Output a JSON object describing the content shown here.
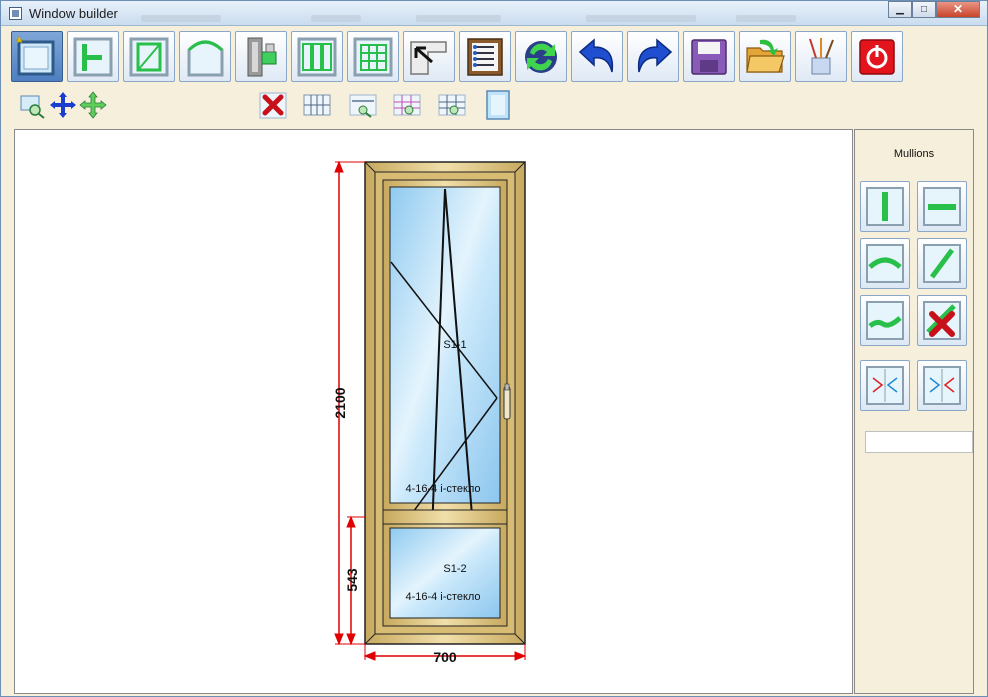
{
  "window": {
    "title": "Window builder",
    "minimize_glyph": "▁",
    "maximize_glyph": "□",
    "close_glyph": "✕"
  },
  "toolbar": {
    "items": [
      {
        "icon": "new-window-icon"
      },
      {
        "icon": "mullion-icon"
      },
      {
        "icon": "sash-icon"
      },
      {
        "icon": "arch-icon"
      },
      {
        "icon": "profile-icon"
      },
      {
        "icon": "triple-sash-icon"
      },
      {
        "icon": "grid-layout-icon"
      },
      {
        "icon": "corner-connector-icon"
      },
      {
        "icon": "properties-list-icon"
      },
      {
        "icon": "refresh-icon"
      },
      {
        "icon": "undo-icon"
      },
      {
        "icon": "redo-icon"
      },
      {
        "icon": "save-icon"
      },
      {
        "icon": "open-folder-icon"
      },
      {
        "icon": "paint-brushes-icon"
      },
      {
        "icon": "exit-icon"
      }
    ]
  },
  "subtoolbar": {
    "items": [
      {
        "icon": "zoom-window-icon"
      },
      {
        "icon": "pan-icon"
      },
      {
        "icon": "move-icon"
      },
      {
        "icon": "delete-icon"
      },
      {
        "icon": "glazing-bars-icon"
      },
      {
        "icon": "dimension-icon"
      },
      {
        "icon": "grid-zoom-icon"
      },
      {
        "icon": "layout-zoom-icon"
      },
      {
        "icon": "glass-pane-icon"
      }
    ]
  },
  "drawing": {
    "height_dim": "2100",
    "width_dim": "700",
    "lower_height_dim": "543",
    "upper_sash_label": "S1-1",
    "upper_glass_label": "4-16-4 i-стекло",
    "lower_sash_label": "S1-2",
    "lower_glass_label": "4-16-4 i-стекло",
    "frame_color": "#e2c98b",
    "glass_color": "#aed9f4",
    "dimension_color": "#e00000"
  },
  "panel": {
    "title": "Mullions",
    "buttons": [
      {
        "icon": "vertical-mullion-icon"
      },
      {
        "icon": "horizontal-mullion-icon"
      },
      {
        "icon": "curved-mullion-icon"
      },
      {
        "icon": "diagonal-mullion-icon"
      },
      {
        "icon": "wave-mullion-icon"
      },
      {
        "icon": "delete-mullion-icon"
      },
      {
        "icon": "mirror-left-icon"
      },
      {
        "icon": "mirror-right-icon"
      }
    ],
    "input_value": ""
  }
}
